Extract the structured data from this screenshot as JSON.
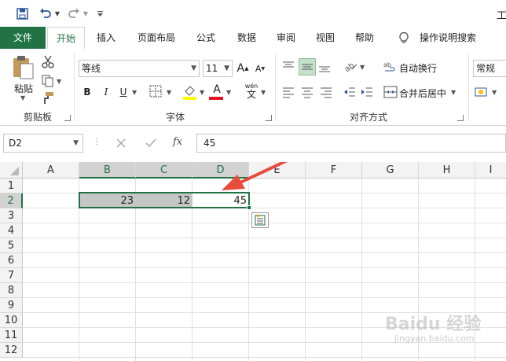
{
  "title_right": "工",
  "tabs": [
    {
      "label": "文件",
      "kind": "file"
    },
    {
      "label": "开始",
      "kind": "active"
    },
    {
      "label": "插入"
    },
    {
      "label": "页面布局"
    },
    {
      "label": "公式"
    },
    {
      "label": "数据"
    },
    {
      "label": "审阅"
    },
    {
      "label": "视图"
    },
    {
      "label": "帮助"
    }
  ],
  "tell_me": "操作说明搜索",
  "ribbon": {
    "paste_label": "粘贴",
    "clipboard_group": "剪贴板",
    "font_group": "字体",
    "align_group": "对齐方式",
    "font_name": "等线",
    "font_size": "11",
    "bold": "B",
    "italic": "I",
    "underline": "U",
    "font_color_a": "A",
    "grow_font": "A",
    "shrink_font": "A",
    "wen": "wén",
    "wrap_text": "自动换行",
    "merge_center": "合并后居中",
    "number_format": "常规"
  },
  "formula_bar": {
    "name_box": "D2",
    "fx": "fx",
    "value": "45"
  },
  "columns": [
    "A",
    "B",
    "C",
    "D",
    "E",
    "F",
    "G",
    "H",
    "I"
  ],
  "rows": [
    "1",
    "2",
    "3",
    "4",
    "5",
    "6",
    "7",
    "8",
    "9",
    "10",
    "11",
    "12"
  ],
  "cells": {
    "B2": "23",
    "C2": "12",
    "D2": "45"
  },
  "watermark": "Baidu 经验",
  "watermark_url": "jingyan.baidu.com",
  "colors": {
    "accent": "#217346",
    "arrow": "#e84a3c"
  }
}
